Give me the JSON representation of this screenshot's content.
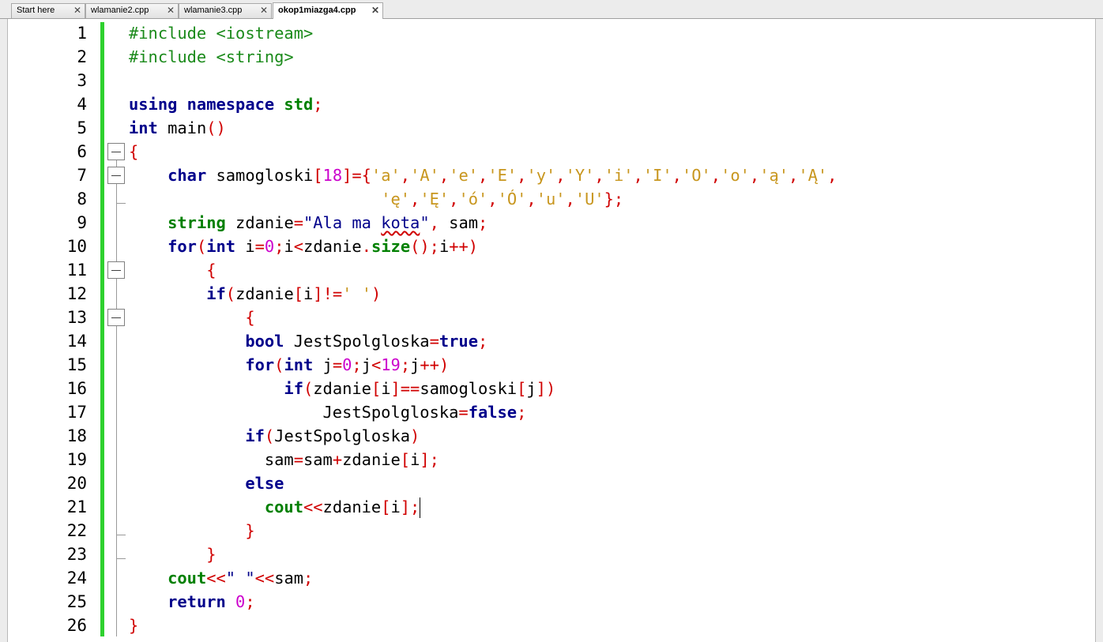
{
  "tabs": [
    {
      "label": "Start here",
      "active": false,
      "close": "✕"
    },
    {
      "label": "wlamanie2.cpp",
      "active": false,
      "close": "✕"
    },
    {
      "label": "wlamanie3.cpp",
      "active": false,
      "close": "✕"
    },
    {
      "label": "okop1miazga4.cpp",
      "active": true,
      "close": "✕"
    }
  ],
  "line_numbers": [
    "1",
    "2",
    "3",
    "4",
    "5",
    "6",
    "7",
    "8",
    "9",
    "10",
    "11",
    "12",
    "13",
    "14",
    "15",
    "16",
    "17",
    "18",
    "19",
    "20",
    "21",
    "22",
    "23",
    "24",
    "25",
    "26"
  ],
  "code_lines": [
    [
      [
        "pp",
        "#include <iostream>"
      ]
    ],
    [
      [
        "pp",
        "#include <string>"
      ]
    ],
    [],
    [
      [
        "kw",
        "using namespace "
      ],
      [
        "kg",
        "std"
      ],
      [
        "op",
        ";"
      ]
    ],
    [
      [
        "kw",
        "int"
      ],
      [
        "id",
        " main"
      ],
      [
        "op",
        "()"
      ]
    ],
    [
      [
        "op",
        "{"
      ]
    ],
    [
      [
        "id",
        "    "
      ],
      [
        "kw",
        "char"
      ],
      [
        "id",
        " samogloski"
      ],
      [
        "op",
        "["
      ],
      [
        "num",
        "18"
      ],
      [
        "op",
        "]={"
      ],
      [
        "chr",
        "'a'"
      ],
      [
        "op",
        ","
      ],
      [
        "chr",
        "'A'"
      ],
      [
        "op",
        ","
      ],
      [
        "chr",
        "'e'"
      ],
      [
        "op",
        ","
      ],
      [
        "chr",
        "'E'"
      ],
      [
        "op",
        ","
      ],
      [
        "chr",
        "'y'"
      ],
      [
        "op",
        ","
      ],
      [
        "chr",
        "'Y'"
      ],
      [
        "op",
        ","
      ],
      [
        "chr",
        "'i'"
      ],
      [
        "op",
        ","
      ],
      [
        "chr",
        "'I'"
      ],
      [
        "op",
        ","
      ],
      [
        "chr",
        "'O'"
      ],
      [
        "op",
        ","
      ],
      [
        "chr",
        "'o'"
      ],
      [
        "op",
        ","
      ],
      [
        "chr",
        "'ą'"
      ],
      [
        "op",
        ","
      ],
      [
        "chr",
        "'Ą'"
      ],
      [
        "op",
        ","
      ]
    ],
    [
      [
        "id",
        "                          "
      ],
      [
        "chr",
        "'ę'"
      ],
      [
        "op",
        ","
      ],
      [
        "chr",
        "'Ę'"
      ],
      [
        "op",
        ","
      ],
      [
        "chr",
        "'ó'"
      ],
      [
        "op",
        ","
      ],
      [
        "chr",
        "'Ó'"
      ],
      [
        "op",
        ","
      ],
      [
        "chr",
        "'u'"
      ],
      [
        "op",
        ","
      ],
      [
        "chr",
        "'U'"
      ],
      [
        "op",
        "};"
      ]
    ],
    [
      [
        "id",
        "    "
      ],
      [
        "kg",
        "string"
      ],
      [
        "id",
        " zdanie"
      ],
      [
        "op",
        "="
      ],
      [
        "str",
        "\"Ala ma "
      ],
      [
        "sq",
        "kota"
      ],
      [
        "str",
        "\""
      ],
      [
        "op",
        ","
      ],
      [
        "id",
        " sam"
      ],
      [
        "op",
        ";"
      ]
    ],
    [
      [
        "id",
        "    "
      ],
      [
        "kw",
        "for"
      ],
      [
        "op",
        "("
      ],
      [
        "kw",
        "int"
      ],
      [
        "id",
        " i"
      ],
      [
        "op",
        "="
      ],
      [
        "num",
        "0"
      ],
      [
        "op",
        ";"
      ],
      [
        "id",
        "i"
      ],
      [
        "op",
        "<"
      ],
      [
        "id",
        "zdanie"
      ],
      [
        "op",
        "."
      ],
      [
        "kg",
        "size"
      ],
      [
        "op",
        "();"
      ],
      [
        "id",
        "i"
      ],
      [
        "op",
        "++)"
      ]
    ],
    [
      [
        "id",
        "        "
      ],
      [
        "op",
        "{"
      ]
    ],
    [
      [
        "id",
        "        "
      ],
      [
        "kw",
        "if"
      ],
      [
        "op",
        "("
      ],
      [
        "id",
        "zdanie"
      ],
      [
        "op",
        "["
      ],
      [
        "id",
        "i"
      ],
      [
        "op",
        "]!="
      ],
      [
        "chr",
        "' '"
      ],
      [
        "op",
        ")"
      ]
    ],
    [
      [
        "id",
        "            "
      ],
      [
        "op",
        "{"
      ]
    ],
    [
      [
        "id",
        "            "
      ],
      [
        "kw",
        "bool"
      ],
      [
        "id",
        " JestSpolgloska"
      ],
      [
        "op",
        "="
      ],
      [
        "kw",
        "true"
      ],
      [
        "op",
        ";"
      ]
    ],
    [
      [
        "id",
        "            "
      ],
      [
        "kw",
        "for"
      ],
      [
        "op",
        "("
      ],
      [
        "kw",
        "int"
      ],
      [
        "id",
        " j"
      ],
      [
        "op",
        "="
      ],
      [
        "num",
        "0"
      ],
      [
        "op",
        ";"
      ],
      [
        "id",
        "j"
      ],
      [
        "op",
        "<"
      ],
      [
        "num",
        "19"
      ],
      [
        "op",
        ";"
      ],
      [
        "id",
        "j"
      ],
      [
        "op",
        "++)"
      ]
    ],
    [
      [
        "id",
        "                "
      ],
      [
        "kw",
        "if"
      ],
      [
        "op",
        "("
      ],
      [
        "id",
        "zdanie"
      ],
      [
        "op",
        "["
      ],
      [
        "id",
        "i"
      ],
      [
        "op",
        "]=="
      ],
      [
        "id",
        "samogloski"
      ],
      [
        "op",
        "["
      ],
      [
        "id",
        "j"
      ],
      [
        "op",
        "])"
      ]
    ],
    [
      [
        "id",
        "                    JestSpolgloska"
      ],
      [
        "op",
        "="
      ],
      [
        "kw",
        "false"
      ],
      [
        "op",
        ";"
      ]
    ],
    [
      [
        "id",
        "            "
      ],
      [
        "kw",
        "if"
      ],
      [
        "op",
        "("
      ],
      [
        "id",
        "JestSpolgloska"
      ],
      [
        "op",
        ")"
      ]
    ],
    [
      [
        "id",
        "              sam"
      ],
      [
        "op",
        "="
      ],
      [
        "id",
        "sam"
      ],
      [
        "op",
        "+"
      ],
      [
        "id",
        "zdanie"
      ],
      [
        "op",
        "["
      ],
      [
        "id",
        "i"
      ],
      [
        "op",
        "];"
      ]
    ],
    [
      [
        "id",
        "            "
      ],
      [
        "kw",
        "else"
      ]
    ],
    [
      [
        "id",
        "              "
      ],
      [
        "kg",
        "cout"
      ],
      [
        "op",
        "<<"
      ],
      [
        "id",
        "zdanie"
      ],
      [
        "op",
        "["
      ],
      [
        "id",
        "i"
      ],
      [
        "op",
        "];"
      ],
      [
        "caret",
        ""
      ]
    ],
    [
      [
        "id",
        "            "
      ],
      [
        "op",
        "}"
      ]
    ],
    [
      [
        "id",
        "        "
      ],
      [
        "op",
        "}"
      ]
    ],
    [
      [
        "id",
        "    "
      ],
      [
        "kg",
        "cout"
      ],
      [
        "op",
        "<<"
      ],
      [
        "str",
        "\" \""
      ],
      [
        "op",
        "<<"
      ],
      [
        "id",
        "sam"
      ],
      [
        "op",
        ";"
      ]
    ],
    [
      [
        "id",
        "    "
      ],
      [
        "kw",
        "return "
      ],
      [
        "num",
        "0"
      ],
      [
        "op",
        ";"
      ]
    ],
    [
      [
        "op",
        "}"
      ]
    ]
  ],
  "colors": {
    "keyword": "#00008b",
    "type_green": "#008000",
    "preprocessor": "#1a8a1a",
    "operator": "#d00000",
    "number": "#cc00cc",
    "char_literal": "#c8961e",
    "change_bar": "#2ed12e"
  },
  "fold_markers": [
    "line-6",
    "line-7",
    "line-11",
    "line-13"
  ]
}
